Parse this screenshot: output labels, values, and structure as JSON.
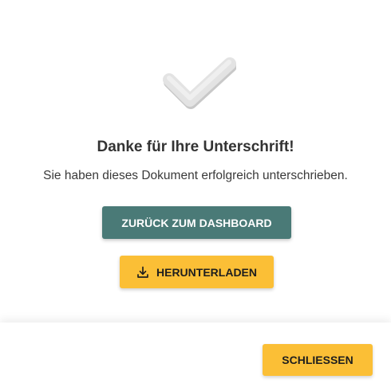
{
  "dialog": {
    "icon": "checkmark-icon",
    "title": "Danke für Ihre Unterschrift!",
    "message": "Sie haben dieses Dokument erfolgreich unterschrieben.",
    "dashboard_button_label": "ZURÜCK ZUM DASHBOARD",
    "download_button_label": "HERUNTERLADEN",
    "download_icon": "download-icon",
    "close_button_label": "SCHLIESSEN"
  },
  "colors": {
    "primary": "#4a7a77",
    "accent": "#fbbf36",
    "text": "#333333",
    "checkmark": "#e0e0e0"
  }
}
